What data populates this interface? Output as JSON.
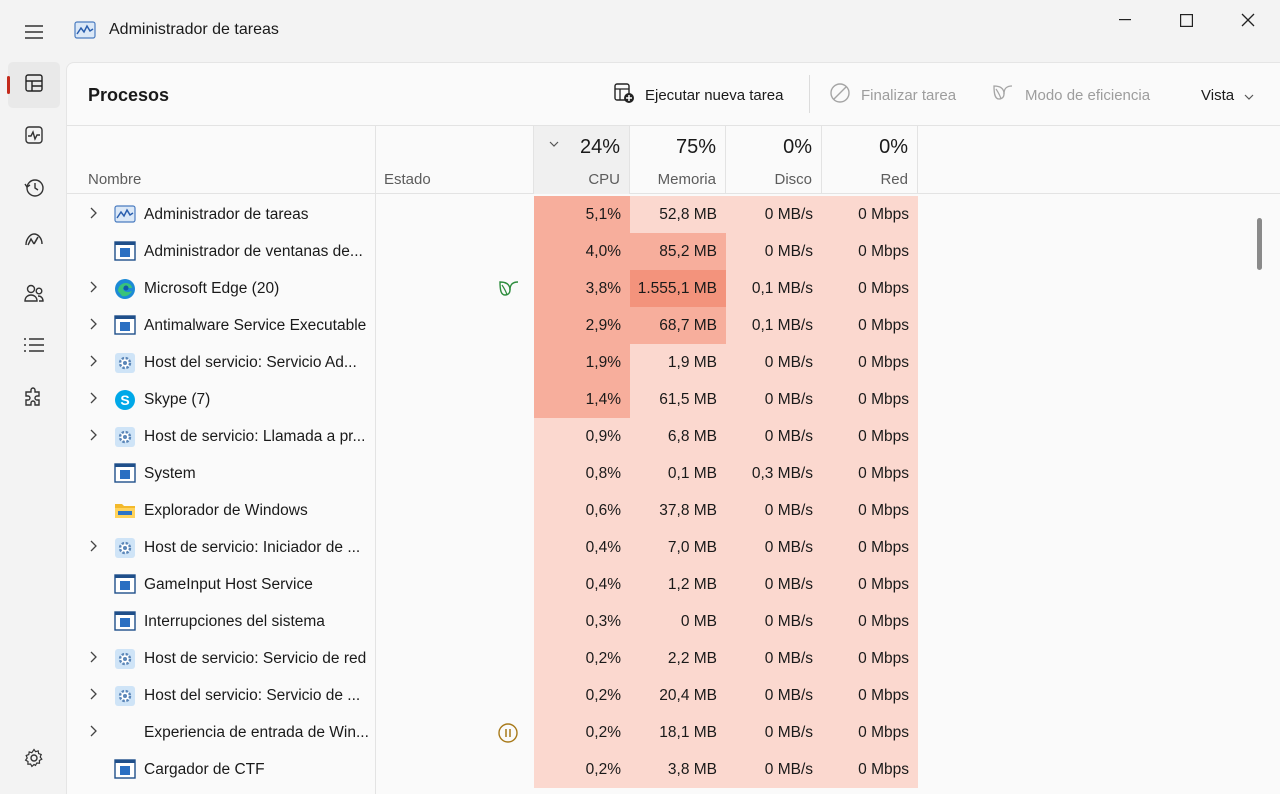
{
  "window": {
    "title": "Administrador de tareas"
  },
  "toolbar": {
    "page_title": "Procesos",
    "run_task_label": "Ejecutar nueva tarea",
    "end_task_label": "Finalizar tarea",
    "efficiency_label": "Modo de eficiencia",
    "view_label": "Vista"
  },
  "columns": {
    "name": "Nombre",
    "status": "Estado",
    "cpu": {
      "label": "CPU",
      "total": "24%"
    },
    "memory": {
      "label": "Memoria",
      "total": "75%"
    },
    "disk": {
      "label": "Disco",
      "total": "0%"
    },
    "network": {
      "label": "Red",
      "total": "0%"
    }
  },
  "colors": {
    "heat_1": "#fbd8cf",
    "heat_2": "#f7ae9c",
    "heat_3": "#f3937c",
    "accent": "#c42b1c"
  },
  "processes": [
    {
      "name": "Administrador de tareas",
      "expandable": true,
      "icon": "task-manager-icon",
      "status_icon": "",
      "cpu": "5,1%",
      "memory": "52,8 MB",
      "disk": "0 MB/s",
      "network": "0 Mbps",
      "cpu_heat": 2,
      "mem_heat": 1,
      "disk_heat": 1
    },
    {
      "name": "Administrador de ventanas de...",
      "expandable": false,
      "icon": "window-app-icon",
      "status_icon": "",
      "cpu": "4,0%",
      "memory": "85,2 MB",
      "disk": "0 MB/s",
      "network": "0 Mbps",
      "cpu_heat": 2,
      "mem_heat": 2,
      "disk_heat": 1
    },
    {
      "name": "Microsoft Edge (20)",
      "expandable": true,
      "icon": "edge-icon",
      "status_icon": "efficiency-leaf-icon",
      "cpu": "3,8%",
      "memory": "1.555,1 MB",
      "disk": "0,1 MB/s",
      "network": "0 Mbps",
      "cpu_heat": 2,
      "mem_heat": 3,
      "disk_heat": 1
    },
    {
      "name": "Antimalware Service Executable",
      "expandable": true,
      "icon": "window-app-icon",
      "status_icon": "",
      "cpu": "2,9%",
      "memory": "68,7 MB",
      "disk": "0,1 MB/s",
      "network": "0 Mbps",
      "cpu_heat": 2,
      "mem_heat": 2,
      "disk_heat": 1
    },
    {
      "name": "Host del servicio: Servicio Ad...",
      "expandable": true,
      "icon": "service-gear-icon",
      "status_icon": "",
      "cpu": "1,9%",
      "memory": "1,9 MB",
      "disk": "0 MB/s",
      "network": "0 Mbps",
      "cpu_heat": 2,
      "mem_heat": 1,
      "disk_heat": 1
    },
    {
      "name": "Skype (7)",
      "expandable": true,
      "icon": "skype-icon",
      "status_icon": "",
      "cpu": "1,4%",
      "memory": "61,5 MB",
      "disk": "0 MB/s",
      "network": "0 Mbps",
      "cpu_heat": 2,
      "mem_heat": 1,
      "disk_heat": 1
    },
    {
      "name": "Host de servicio: Llamada a pr...",
      "expandable": true,
      "icon": "service-gear-icon",
      "status_icon": "",
      "cpu": "0,9%",
      "memory": "6,8 MB",
      "disk": "0 MB/s",
      "network": "0 Mbps",
      "cpu_heat": 1,
      "mem_heat": 1,
      "disk_heat": 1
    },
    {
      "name": "System",
      "expandable": false,
      "icon": "window-app-icon",
      "status_icon": "",
      "cpu": "0,8%",
      "memory": "0,1 MB",
      "disk": "0,3 MB/s",
      "network": "0 Mbps",
      "cpu_heat": 1,
      "mem_heat": 1,
      "disk_heat": 1
    },
    {
      "name": "Explorador de Windows",
      "expandable": false,
      "icon": "folder-icon",
      "status_icon": "",
      "cpu": "0,6%",
      "memory": "37,8 MB",
      "disk": "0 MB/s",
      "network": "0 Mbps",
      "cpu_heat": 1,
      "mem_heat": 1,
      "disk_heat": 1
    },
    {
      "name": "Host de servicio: Iniciador de ...",
      "expandable": true,
      "icon": "service-gear-icon",
      "status_icon": "",
      "cpu": "0,4%",
      "memory": "7,0 MB",
      "disk": "0 MB/s",
      "network": "0 Mbps",
      "cpu_heat": 1,
      "mem_heat": 1,
      "disk_heat": 1
    },
    {
      "name": "GameInput Host Service",
      "expandable": false,
      "icon": "window-app-icon",
      "status_icon": "",
      "cpu": "0,4%",
      "memory": "1,2 MB",
      "disk": "0 MB/s",
      "network": "0 Mbps",
      "cpu_heat": 1,
      "mem_heat": 1,
      "disk_heat": 1
    },
    {
      "name": "Interrupciones del sistema",
      "expandable": false,
      "icon": "window-app-icon",
      "status_icon": "",
      "cpu": "0,3%",
      "memory": "0 MB",
      "disk": "0 MB/s",
      "network": "0 Mbps",
      "cpu_heat": 1,
      "mem_heat": 1,
      "disk_heat": 1
    },
    {
      "name": "Host de servicio: Servicio de red",
      "expandable": true,
      "icon": "service-gear-icon",
      "status_icon": "",
      "cpu": "0,2%",
      "memory": "2,2 MB",
      "disk": "0 MB/s",
      "network": "0 Mbps",
      "cpu_heat": 1,
      "mem_heat": 1,
      "disk_heat": 1
    },
    {
      "name": "Host del servicio: Servicio de ...",
      "expandable": true,
      "icon": "service-gear-icon",
      "status_icon": "",
      "cpu": "0,2%",
      "memory": "20,4 MB",
      "disk": "0 MB/s",
      "network": "0 Mbps",
      "cpu_heat": 1,
      "mem_heat": 1,
      "disk_heat": 1
    },
    {
      "name": "Experiencia de entrada de Win...",
      "expandable": true,
      "icon": "",
      "status_icon": "suspended-pause-icon",
      "cpu": "0,2%",
      "memory": "18,1 MB",
      "disk": "0 MB/s",
      "network": "0 Mbps",
      "cpu_heat": 1,
      "mem_heat": 1,
      "disk_heat": 1
    },
    {
      "name": "Cargador de CTF",
      "expandable": false,
      "icon": "window-app-icon",
      "status_icon": "",
      "cpu": "0,2%",
      "memory": "3,8 MB",
      "disk": "0 MB/s",
      "network": "0 Mbps",
      "cpu_heat": 1,
      "mem_heat": 1,
      "disk_heat": 1
    }
  ]
}
